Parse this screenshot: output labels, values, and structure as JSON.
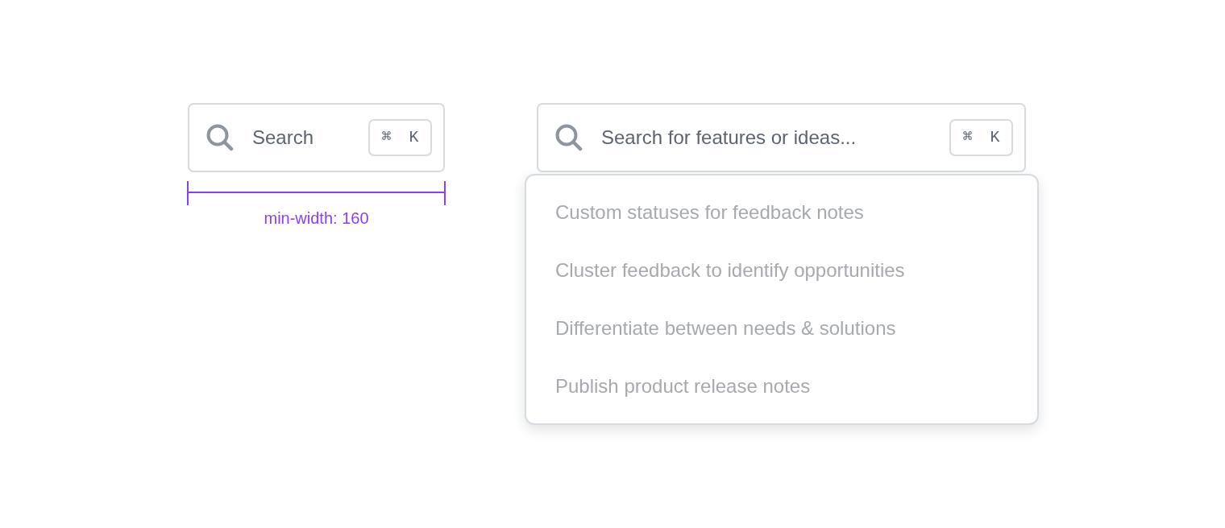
{
  "search_fields": [
    {
      "placeholder": "Search",
      "shortcut": "⌘ K"
    },
    {
      "placeholder": "Search for features or ideas...",
      "shortcut": "⌘ K",
      "dropdown": {
        "items": [
          {
            "label": "Custom statuses for feedback notes",
            "selected": false
          },
          {
            "label": "Cluster feedback to identify opportunities",
            "selected": false
          },
          {
            "label": "Differentiate between needs & solutions",
            "selected": false
          },
          {
            "label": "Publish product release notes",
            "selected": false
          }
        ]
      }
    }
  ],
  "annotation": {
    "label": "min-width: 160"
  }
}
